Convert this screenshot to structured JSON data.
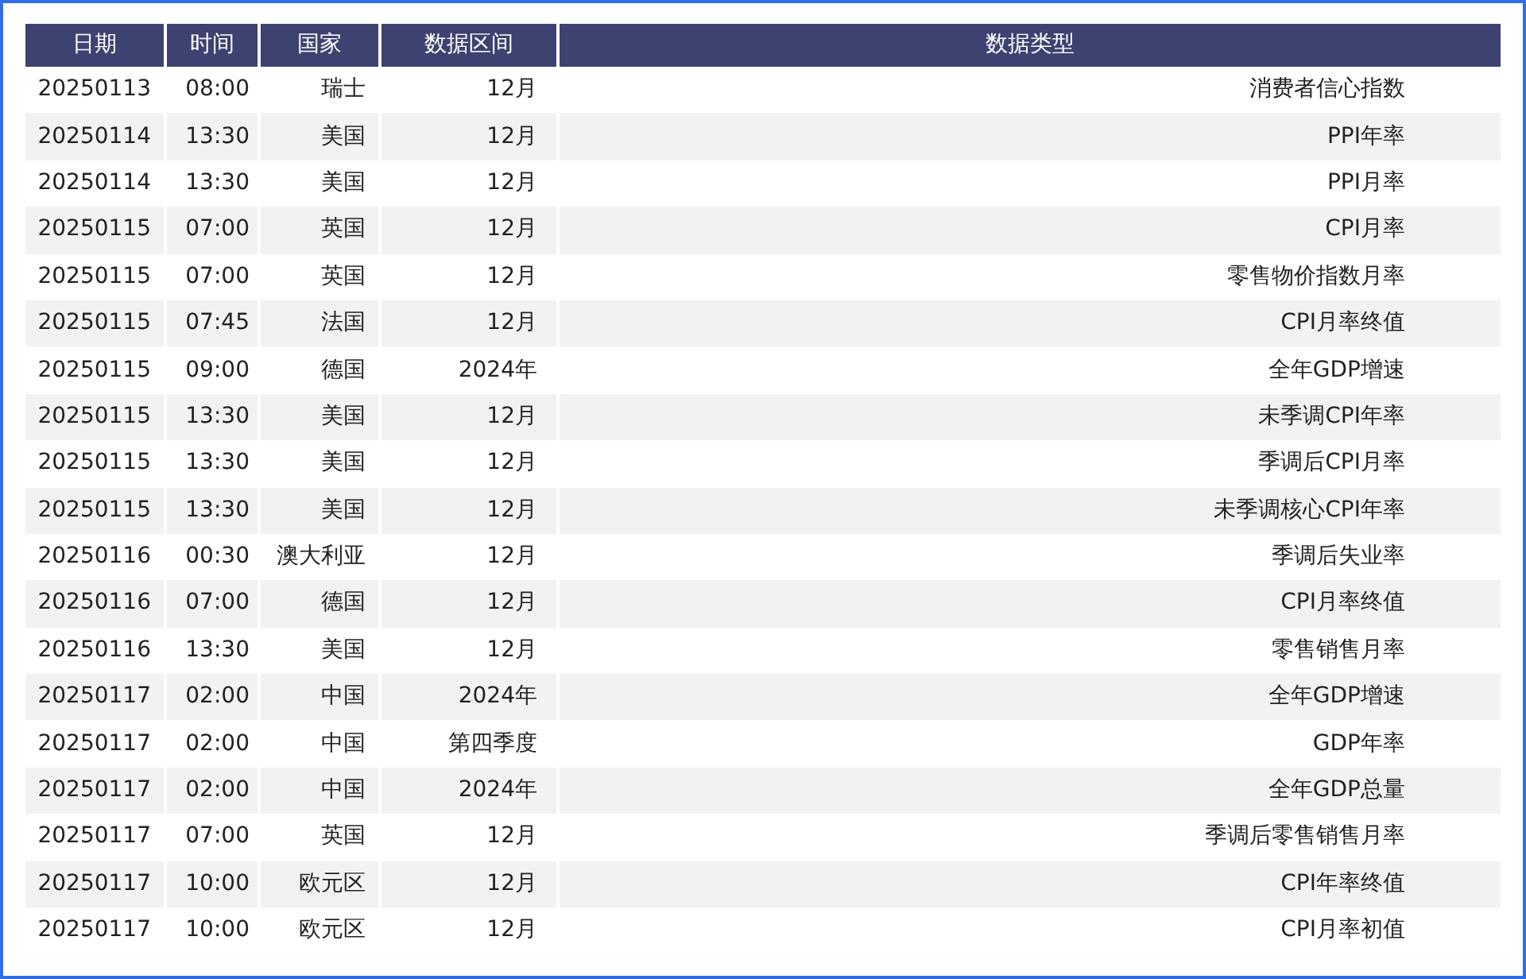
{
  "table": {
    "columns": [
      "日期",
      "时间",
      "国家",
      "数据区间",
      "数据类型"
    ],
    "rows": [
      [
        "20250113",
        "08:00",
        "瑞士",
        "12月",
        "消费者信心指数"
      ],
      [
        "20250114",
        "13:30",
        "美国",
        "12月",
        "PPI年率"
      ],
      [
        "20250114",
        "13:30",
        "美国",
        "12月",
        "PPI月率"
      ],
      [
        "20250115",
        "07:00",
        "英国",
        "12月",
        "CPI月率"
      ],
      [
        "20250115",
        "07:00",
        "英国",
        "12月",
        "零售物价指数月率"
      ],
      [
        "20250115",
        "07:45",
        "法国",
        "12月",
        "CPI月率终值"
      ],
      [
        "20250115",
        "09:00",
        "德国",
        "2024年",
        "全年GDP增速"
      ],
      [
        "20250115",
        "13:30",
        "美国",
        "12月",
        "未季调CPI年率"
      ],
      [
        "20250115",
        "13:30",
        "美国",
        "12月",
        "季调后CPI月率"
      ],
      [
        "20250115",
        "13:30",
        "美国",
        "12月",
        "未季调核心CPI年率"
      ],
      [
        "20250116",
        "00:30",
        "澳大利亚",
        "12月",
        "季调后失业率"
      ],
      [
        "20250116",
        "07:00",
        "德国",
        "12月",
        "CPI月率终值"
      ],
      [
        "20250116",
        "13:30",
        "美国",
        "12月",
        "零售销售月率"
      ],
      [
        "20250117",
        "02:00",
        "中国",
        "2024年",
        "全年GDP增速"
      ],
      [
        "20250117",
        "02:00",
        "中国",
        "第四季度",
        "GDP年率"
      ],
      [
        "20250117",
        "02:00",
        "中国",
        "2024年",
        "全年GDP总量"
      ],
      [
        "20250117",
        "07:00",
        "英国",
        "12月",
        "季调后零售销售月率"
      ],
      [
        "20250117",
        "10:00",
        "欧元区",
        "12月",
        "CPI年率终值"
      ],
      [
        "20250117",
        "10:00",
        "欧元区",
        "12月",
        "CPI月率初值"
      ]
    ]
  }
}
